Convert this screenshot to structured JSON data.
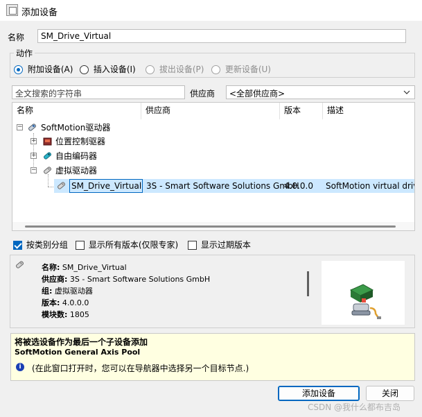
{
  "window": {
    "title": "添加设备"
  },
  "name_row": {
    "label": "名称",
    "value": "SM_Drive_Virtual"
  },
  "action": {
    "legend": "动作",
    "options": [
      {
        "label": "附加设备(A)",
        "checked": true,
        "disabled": false
      },
      {
        "label": "插入设备(I)",
        "checked": false,
        "disabled": false
      },
      {
        "label": "拔出设备(P)",
        "checked": false,
        "disabled": true
      },
      {
        "label": "更新设备(U)",
        "checked": false,
        "disabled": true
      }
    ]
  },
  "search": {
    "placeholder": "全文搜索的字符串",
    "vendor_label": "供应商",
    "vendor_value": "<全部供应商>"
  },
  "tree": {
    "columns": [
      "名称",
      "供应商",
      "版本",
      "描述"
    ],
    "rows": [
      {
        "name": "SoftMotion驱动器",
        "vendor": "",
        "version": "",
        "desc": ""
      },
      {
        "name": "位置控制驱器",
        "vendor": "",
        "version": "",
        "desc": ""
      },
      {
        "name": "自由编码器",
        "vendor": "",
        "version": "",
        "desc": ""
      },
      {
        "name": "虚拟驱动器",
        "vendor": "",
        "version": "",
        "desc": ""
      },
      {
        "name": "SM_Drive_Virtual",
        "vendor": "3S - Smart Software Solutions GmbH",
        "version": "4.0.0.0",
        "desc": "SoftMotion virtual drive"
      }
    ]
  },
  "options": {
    "group_by_category": {
      "label": "按类别分组",
      "checked": true
    },
    "show_all_versions": {
      "label": "显示所有版本(仅限专家)",
      "checked": false
    },
    "show_outdated": {
      "label": "显示过期版本",
      "checked": false
    }
  },
  "details": {
    "name_label": "名称:",
    "name_value": "SM_Drive_Virtual",
    "vendor_label": "供应商:",
    "vendor_value": "3S - Smart Software Solutions GmbH",
    "group_label": "组:",
    "group_value": "虚拟驱动器",
    "version_label": "版本:",
    "version_value": "4.0.0.0",
    "model_label": "模块数:",
    "model_value": "1805"
  },
  "info": {
    "title": "将被选设备作为最后一个子设备添加",
    "subtitle": "SoftMotion General Axis Pool",
    "note": "(在此窗口打开时，您可以在导航器中选择另一个目标节点.)"
  },
  "buttons": {
    "add": "添加设备",
    "close": "关闭"
  },
  "watermark": "CSDN @我什么都布吉岛",
  "colors": {
    "accent": "#0067c0",
    "selection": "#cce8ff",
    "info_bg": "#ffffe1"
  }
}
